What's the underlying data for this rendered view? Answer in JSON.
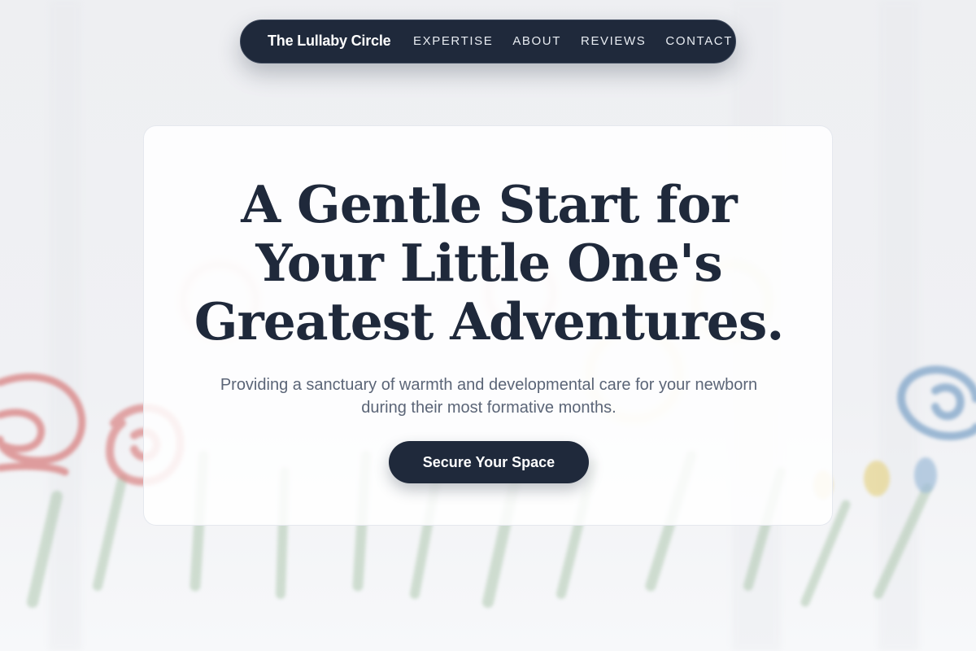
{
  "nav": {
    "brand": "The Lullaby Circle",
    "links": [
      {
        "label": "EXPERTISE"
      },
      {
        "label": "ABOUT"
      },
      {
        "label": "REVIEWS"
      },
      {
        "label": "CONTACT"
      }
    ]
  },
  "hero": {
    "headline_lines": [
      "A Gentle Start for",
      "Your Little One's",
      "Greatest Adventures."
    ],
    "subtext_lines": [
      "Providing a sanctuary of warmth and developmental care for your newborn",
      "during their most formative months."
    ],
    "cta_label": "Secure Your Space"
  },
  "colors": {
    "navy": "#1f293b",
    "text_muted": "#5b6577",
    "background": "#eeeff2",
    "crayon_red": "#d47a7a",
    "crayon_blue": "#7fa6c8",
    "crayon_yellow": "#e2cb6a",
    "crayon_green": "#8fb08f"
  }
}
